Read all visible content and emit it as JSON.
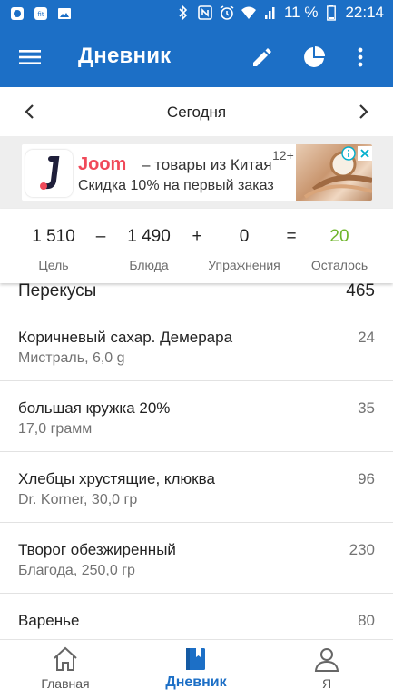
{
  "status_bar": {
    "battery": "11 %",
    "time": "22:14"
  },
  "app_bar": {
    "title": "Дневник"
  },
  "date_nav": {
    "label": "Сегодня"
  },
  "ad": {
    "brand": "Joom",
    "tagline": "– товары из Китая",
    "subtext": "Скидка 10% на первый заказ",
    "age_rating": "12+"
  },
  "summary": {
    "goal_value": "1 510",
    "goal_label": "Цель",
    "minus": "–",
    "food_value": "1 490",
    "food_label": "Блюда",
    "plus": "+",
    "exercise_value": "0",
    "exercise_label": "Упражнения",
    "equals": "=",
    "remaining_value": "20",
    "remaining_label": "Осталось",
    "remaining_color": "#6fb52b"
  },
  "section": {
    "title": "Перекусы",
    "total": "465"
  },
  "entries": [
    {
      "name": "Коричневый сахар. Демерара",
      "detail": "Мистраль, 6,0 g",
      "calories": "24"
    },
    {
      "name": "большая кружка 20%",
      "detail": "17,0 грамм",
      "calories": "35"
    },
    {
      "name": "Хлебцы хрустящие, клюква",
      "detail": "Dr. Korner, 30,0 гр",
      "calories": "96"
    },
    {
      "name": "Творог обезжиренный",
      "detail": "Благода, 250,0 гр",
      "calories": "230"
    },
    {
      "name": "Варенье",
      "detail": "",
      "calories": "80"
    }
  ],
  "bottom_nav": {
    "home": "Главная",
    "diary": "Дневник",
    "me": "Я"
  },
  "colors": {
    "primary": "#1c6fc6",
    "accent_green": "#6fb52b",
    "ad_brand": "#f04a5a"
  }
}
